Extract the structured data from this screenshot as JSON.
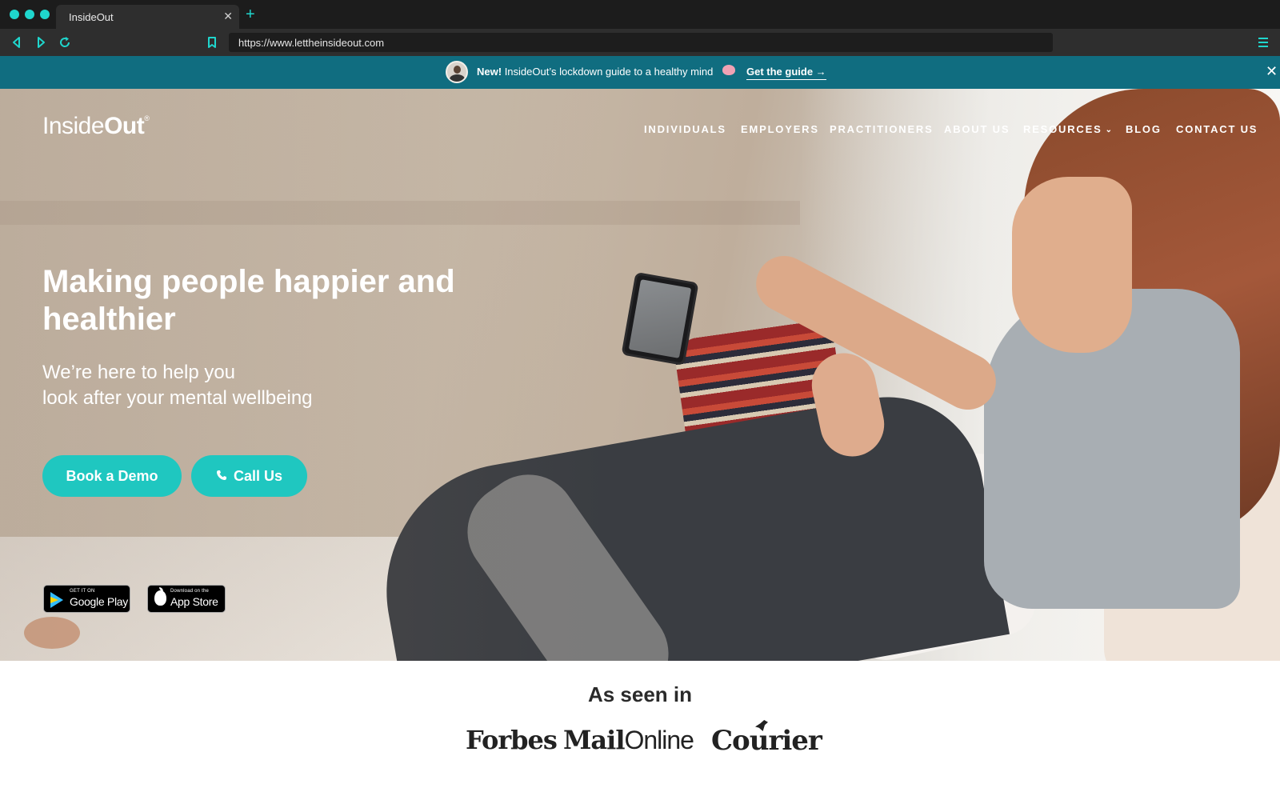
{
  "browser": {
    "tab_title": "InsideOut",
    "tab_close": "✕",
    "new_tab": "+",
    "url": "https://www.lettheinsideout.com"
  },
  "announcement": {
    "new_label": "New!",
    "text": "InsideOut’s lockdown guide to a healthy mind",
    "link_label": "Get the guide →",
    "close": "✕"
  },
  "header": {
    "logo_light": "Inside",
    "logo_bold": "Out",
    "logo_mark": "®",
    "nav": [
      {
        "label": "INDIVIDUALS"
      },
      {
        "label": "EMPLOYERS"
      },
      {
        "label": "PRACTITIONERS"
      },
      {
        "label": "ABOUT US"
      },
      {
        "label": "RESOURCES",
        "has_dropdown": true
      },
      {
        "label": "BLOG"
      },
      {
        "label": "CONTACT US"
      }
    ]
  },
  "hero": {
    "headline": "Making people happier and healthier",
    "sub_line_1": "We’re here to help you",
    "sub_line_2": "look after your mental wellbeing",
    "cta_primary": "Book a Demo",
    "cta_secondary": "Call Us",
    "cta_secondary_icon": "phone-icon"
  },
  "stores": {
    "google_small": "GET IT ON",
    "google_big": "Google Play",
    "apple_small": "Download on the",
    "apple_big": "App Store"
  },
  "press": {
    "title": "As seen in",
    "logos": [
      "Forbes",
      "Mail",
      "Online",
      "Courier"
    ]
  },
  "colors": {
    "accent": "#1fc7c0",
    "announcement_bg": "#106d80",
    "chrome_accent": "#1fd6cd"
  }
}
